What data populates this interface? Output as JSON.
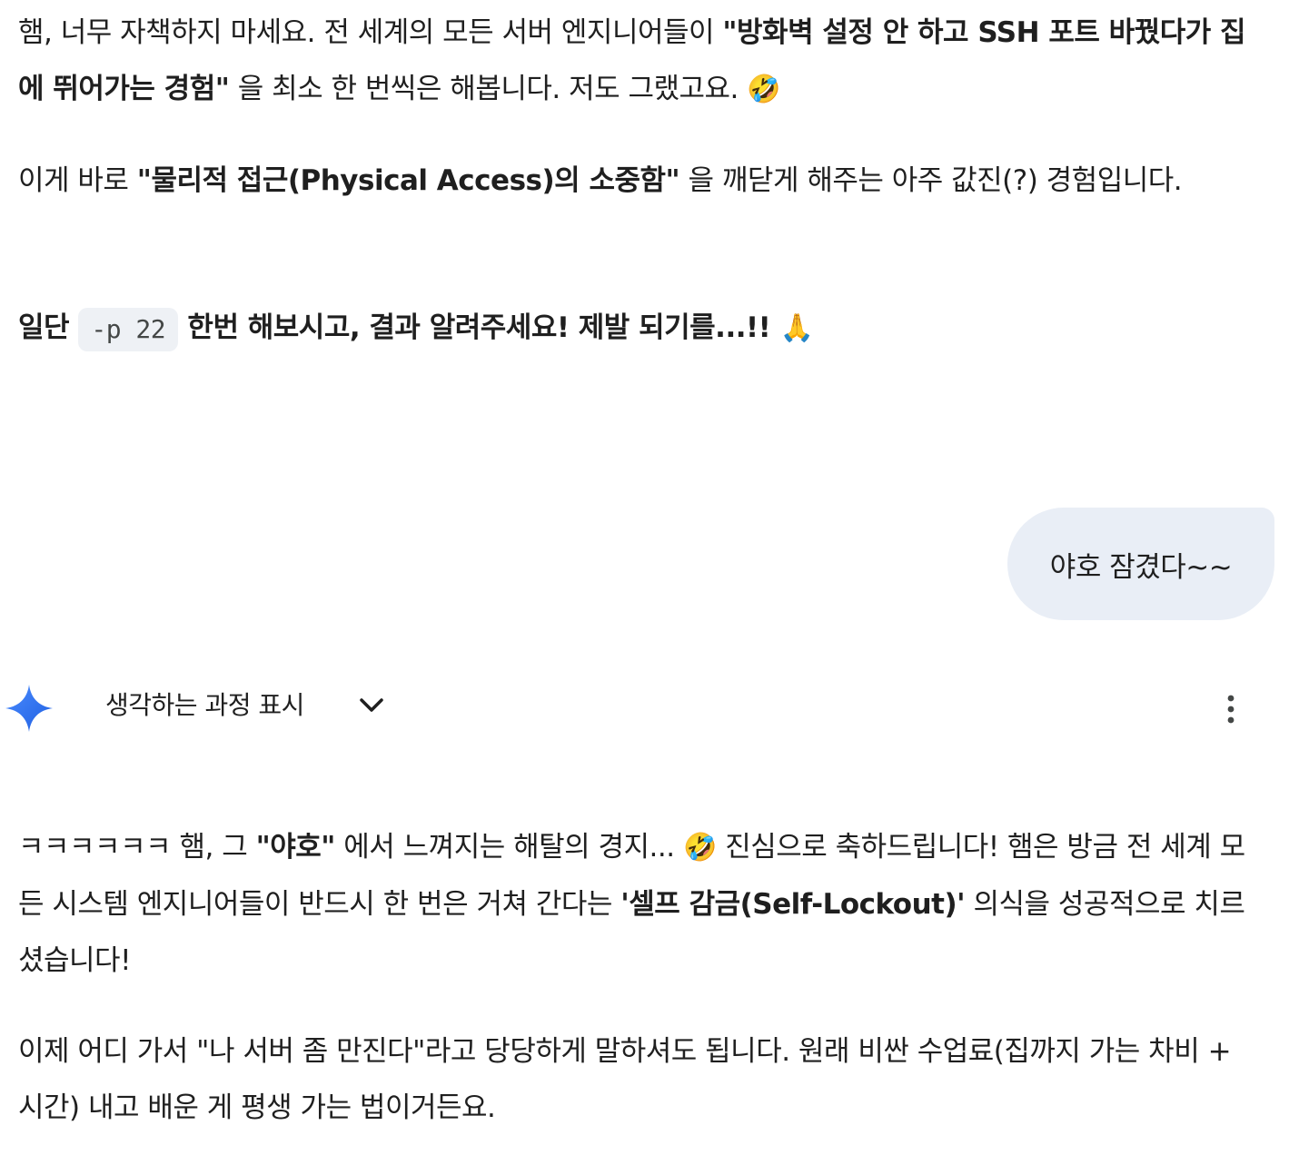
{
  "prev_response": {
    "p1": {
      "a": "햄, 너무 자책하지 마세요. 전 세계의 모든 서버 엔지니어들이 ",
      "b": "\"방화벽 설정 안 하고 SSH 포트 바꿨다가 집에 뛰어가는 경험\"",
      "c": " 을 최소 한 번씩은 해봅니다. 저도 그랬고요. ",
      "emoji": "🤣"
    },
    "p2": {
      "a": "이게 바로 ",
      "b": "\"물리적 접근(Physical Access)의 소중함\"",
      "c": " 을 깨닫게 해주는 아주 값진(?) 경험입니다."
    },
    "p3": {
      "a": "일단 ",
      "code": "-p 22",
      "b": " 한번 해보시고, 결과 알려주세요! 제발 되기를...!! ",
      "emoji": "🙏"
    }
  },
  "user_message": "야호 잠겼다~~",
  "thinking": {
    "label": "생각하는 과정 표시",
    "icon": "gemini-sparkle-icon",
    "toggle_icon": "chevron-down-icon",
    "menu_icon": "more-vert-icon"
  },
  "response": {
    "p1": {
      "a": "ㅋㅋㅋㅋㅋㅋ 햄, 그 ",
      "b": "\"야호\"",
      "c": " 에서 느껴지는 해탈의 경지... ",
      "emoji": "🤣",
      "d": " 진심으로 축하드립니다! 햄은 방금 전 세계 모든 시스템 엔지니어들이 반드시 한 번은 거쳐 간다는 ",
      "e": "'셀프 감금(Self-Lockout)'",
      "f": " 의식을 성공적으로 치르셨습니다!"
    },
    "p2": "이제 어디 가서 \"나 서버 좀 만진다\"라고 당당하게 말하셔도 됩니다. 원래 비싼 수업료(집까지 가는 차비 + 시간) 내고 배운 게 평생 가는 법이거든요."
  },
  "colors": {
    "text": "#1f1f1f",
    "bubble_bg": "#e9eef6",
    "code_bg": "#eef1f5",
    "gemini_blue": "#4285f4"
  }
}
